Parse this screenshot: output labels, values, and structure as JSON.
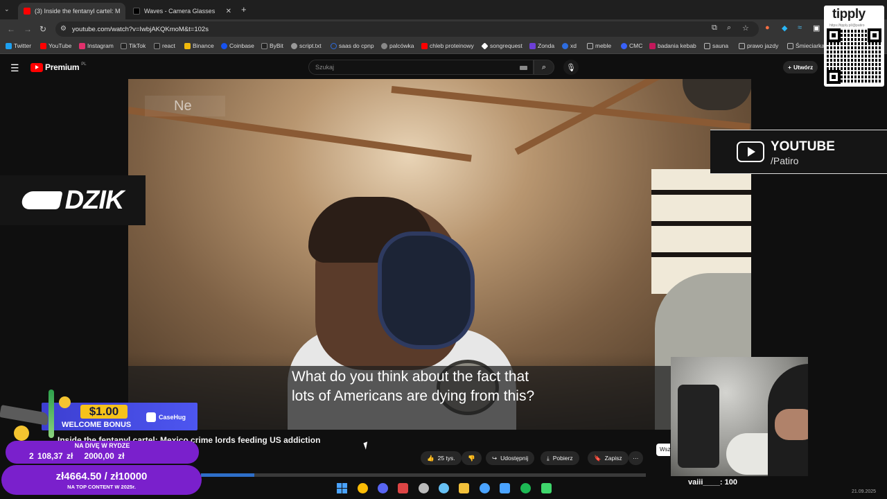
{
  "browser": {
    "tabs": [
      {
        "label": "(3) Inside the fentanyl cartel: M",
        "active": true,
        "favicon_color": "#ff0000"
      },
      {
        "label": "Waves - Camera Glasses",
        "active": false,
        "favicon_color": "#000000"
      }
    ],
    "new_tab": "+",
    "url": "youtube.com/watch?v=IwbjAKQKmoM&t=102s",
    "bookmarks": [
      {
        "label": "Twitter",
        "color": "#1da1f2"
      },
      {
        "label": "YouTube",
        "color": "#ff0000"
      },
      {
        "label": "Instagram",
        "color": "#e1306c"
      },
      {
        "label": "TikTok",
        "color": "#222222"
      },
      {
        "label": "react",
        "color": "#222222"
      },
      {
        "label": "Binance",
        "color": "#f0b90b"
      },
      {
        "label": "Coinbase",
        "color": "#1652f0"
      },
      {
        "label": "ByBit",
        "color": "#222222"
      },
      {
        "label": "script.txt",
        "color": "#999999"
      },
      {
        "label": "saas do cpnp",
        "color": "#2d6cdf"
      },
      {
        "label": "palcówka",
        "color": "#888888"
      },
      {
        "label": "chleb proteinowy",
        "color": "#ff0000"
      },
      {
        "label": "songrequest",
        "color": "#ffffff"
      },
      {
        "label": "Zonda",
        "color": "#6d3fd6"
      },
      {
        "label": "xd",
        "color": "#2d6cdf"
      },
      {
        "label": "meble",
        "color": "#bbbbbb"
      },
      {
        "label": "CMC",
        "color": "#3861fb"
      },
      {
        "label": "badania kebab",
        "color": "#c2185b"
      },
      {
        "label": "sauna",
        "color": "#bbbbbb"
      },
      {
        "label": "prawo jazdy",
        "color": "#bbbbbb"
      },
      {
        "label": "Śmieciarka",
        "color": "#bbbbbb"
      }
    ]
  },
  "youtube": {
    "brand": "Premium",
    "region": "PL",
    "search_placeholder": "Szukaj",
    "create_label": "Utwórz",
    "video_title": "Inside the fentanyl cartel: Mexico crime lords feeding US addiction",
    "subtitle_line1": "What do you think about the fact that",
    "subtitle_line2": "lots of Americans are dying from this?",
    "watermark": "Ne",
    "likes": "25 tys.",
    "share_label": "Udostępnij",
    "download_label": "Pobierz",
    "save_label": "Zapisz",
    "more_label": "···",
    "progress_fraction": 0.12,
    "side_tab": "Wsz"
  },
  "overlays": {
    "dzik": "DZIK",
    "yt_channel_title": "YOUTUBE",
    "yt_channel_handle": "/Patiro",
    "tipply_brand": "tipply",
    "tipply_url": "https://tipply.pl/@patiro",
    "casehug_amount": "$1.00",
    "casehug_bonus": "WELCOME BONUS",
    "casehug_brand": "CaseHug",
    "goal1_label": "NA DIVĘ W RYDZE",
    "goal1_current": "2 108,37 zł",
    "goal1_target": "2000,00 zł",
    "goal2_values": "zł4664.50 / zł10000",
    "goal2_label": "NA TOP CONTENT W 2025r.",
    "chat_line": "vaiii____: 100"
  },
  "taskbar": {
    "apps": [
      {
        "name": "chrome",
        "color": "#fbbc05"
      },
      {
        "name": "discord",
        "color": "#5865f2"
      },
      {
        "name": "app-red",
        "color": "#d44"
      },
      {
        "name": "app-gray",
        "color": "#bbbbbb"
      },
      {
        "name": "steam",
        "color": "#66c0f4"
      },
      {
        "name": "explorer",
        "color": "#f3c13a"
      },
      {
        "name": "c-app",
        "color": "#4aa3ff"
      },
      {
        "name": "tool",
        "color": "#4aa3ff"
      },
      {
        "name": "spotify",
        "color": "#1db954"
      },
      {
        "name": "notes",
        "color": "#3fd66c"
      }
    ],
    "date": "21.09.2025"
  }
}
